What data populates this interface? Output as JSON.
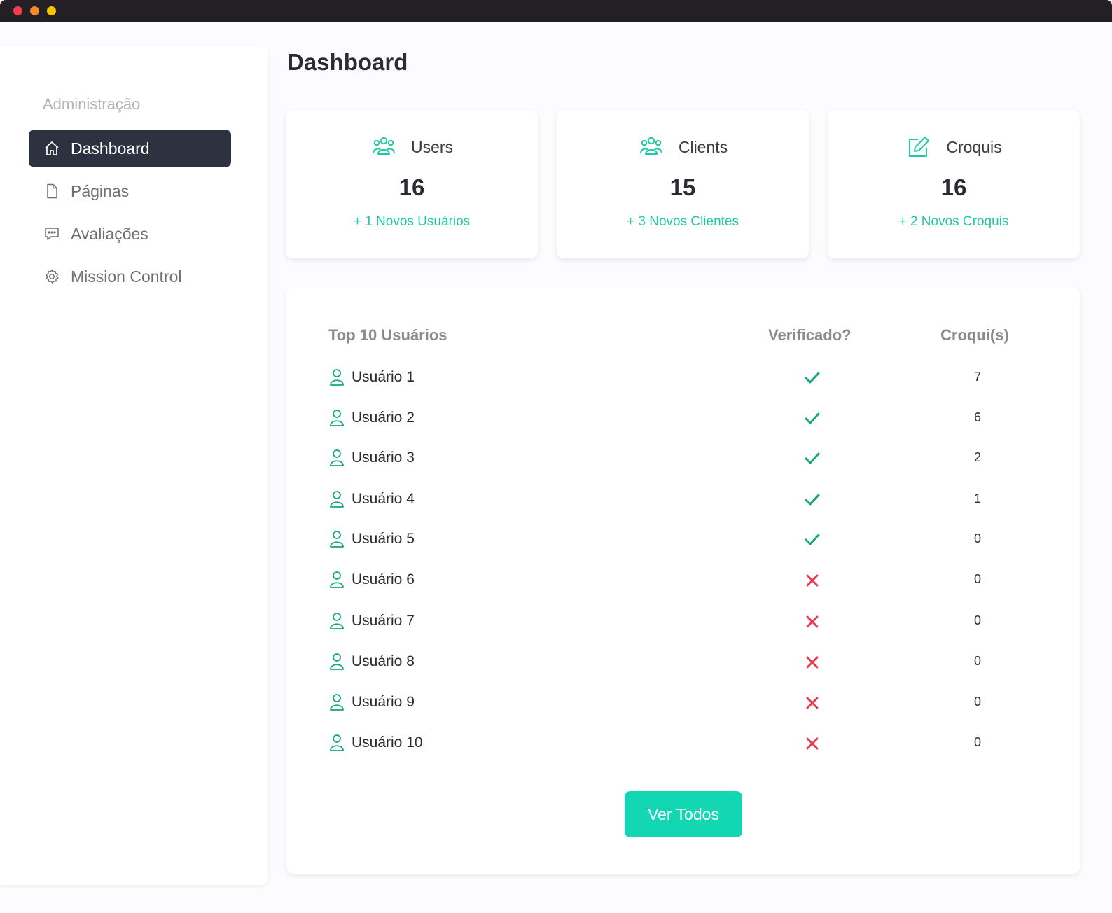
{
  "sidebar": {
    "section_label": "Administração",
    "items": [
      {
        "label": "Dashboard",
        "icon": "home-icon",
        "active": true
      },
      {
        "label": "Páginas",
        "icon": "document-icon",
        "active": false
      },
      {
        "label": "Avaliações",
        "icon": "chat-icon",
        "active": false
      },
      {
        "label": "Mission Control",
        "icon": "gear-icon",
        "active": false
      }
    ]
  },
  "page": {
    "title": "Dashboard"
  },
  "stats": [
    {
      "title": "Users",
      "value": "16",
      "sub": "+ 1 Novos Usuários",
      "icon": "users-group-icon"
    },
    {
      "title": "Clients",
      "value": "15",
      "sub": "+ 3 Novos Clientes",
      "icon": "clients-group-icon"
    },
    {
      "title": "Croquis",
      "value": "16",
      "sub": "+ 2 Novos Croquis",
      "icon": "edit-icon"
    }
  ],
  "table": {
    "headers": {
      "user": "Top 10 Usuários",
      "verified": "Verificado?",
      "count": "Croqui(s)"
    },
    "rows": [
      {
        "name": "Usuário 1",
        "verified": true,
        "count": "7"
      },
      {
        "name": "Usuário 2",
        "verified": true,
        "count": "6"
      },
      {
        "name": "Usuário 3",
        "verified": true,
        "count": "2"
      },
      {
        "name": "Usuário 4",
        "verified": true,
        "count": "1"
      },
      {
        "name": "Usuário 5",
        "verified": true,
        "count": "0"
      },
      {
        "name": "Usuário 6",
        "verified": false,
        "count": "0"
      },
      {
        "name": "Usuário 7",
        "verified": false,
        "count": "0"
      },
      {
        "name": "Usuário 8",
        "verified": false,
        "count": "0"
      },
      {
        "name": "Usuário 9",
        "verified": false,
        "count": "0"
      },
      {
        "name": "Usuário 10",
        "verified": false,
        "count": "0"
      }
    ],
    "button_label": "Ver Todos"
  },
  "colors": {
    "accent": "#13d6b2",
    "check": "#17a57d",
    "cross": "#e53c4e",
    "active_nav": "#2d3140"
  }
}
